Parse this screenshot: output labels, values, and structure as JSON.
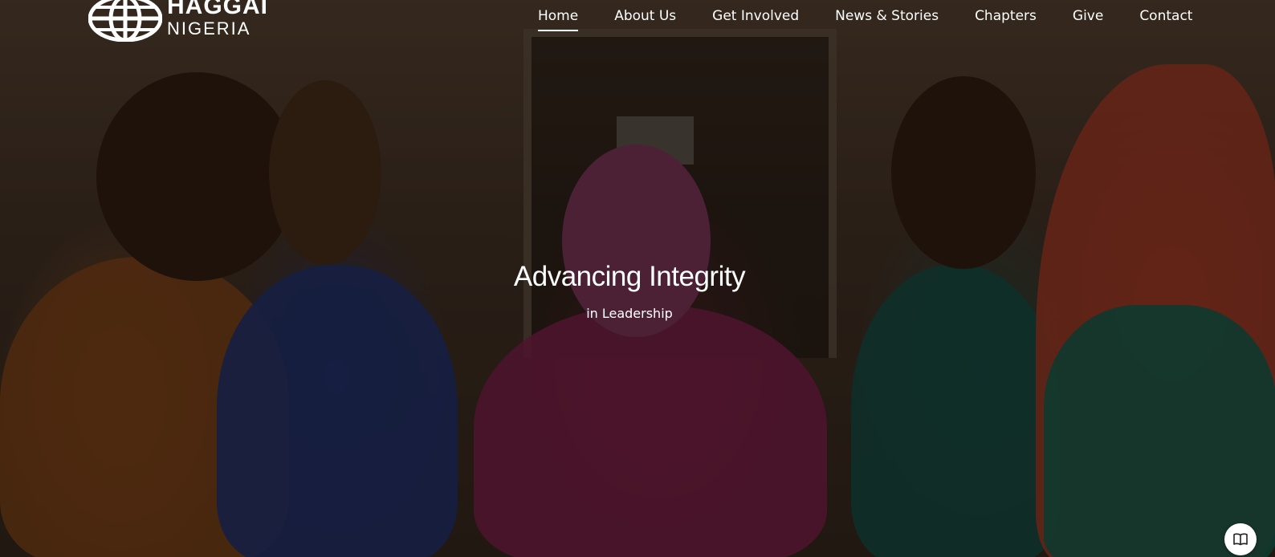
{
  "brand": {
    "line_1": "HAGGAI",
    "line_2": "NIGERIA",
    "logo_icon": "globe-icon"
  },
  "nav": {
    "items": [
      {
        "label": "Home",
        "active": true
      },
      {
        "label": "About Us",
        "active": false
      },
      {
        "label": "Get Involved",
        "active": false
      },
      {
        "label": "News & Stories",
        "active": false
      },
      {
        "label": "Chapters",
        "active": false
      },
      {
        "label": "Give",
        "active": false
      },
      {
        "label": "Contact",
        "active": false
      }
    ]
  },
  "hero": {
    "title": "Advancing Integrity",
    "subtitle": "in Leadership"
  },
  "floating_button": {
    "icon": "book-open-icon"
  },
  "colors": {
    "text": "#ffffff",
    "overlay": "#000000"
  }
}
